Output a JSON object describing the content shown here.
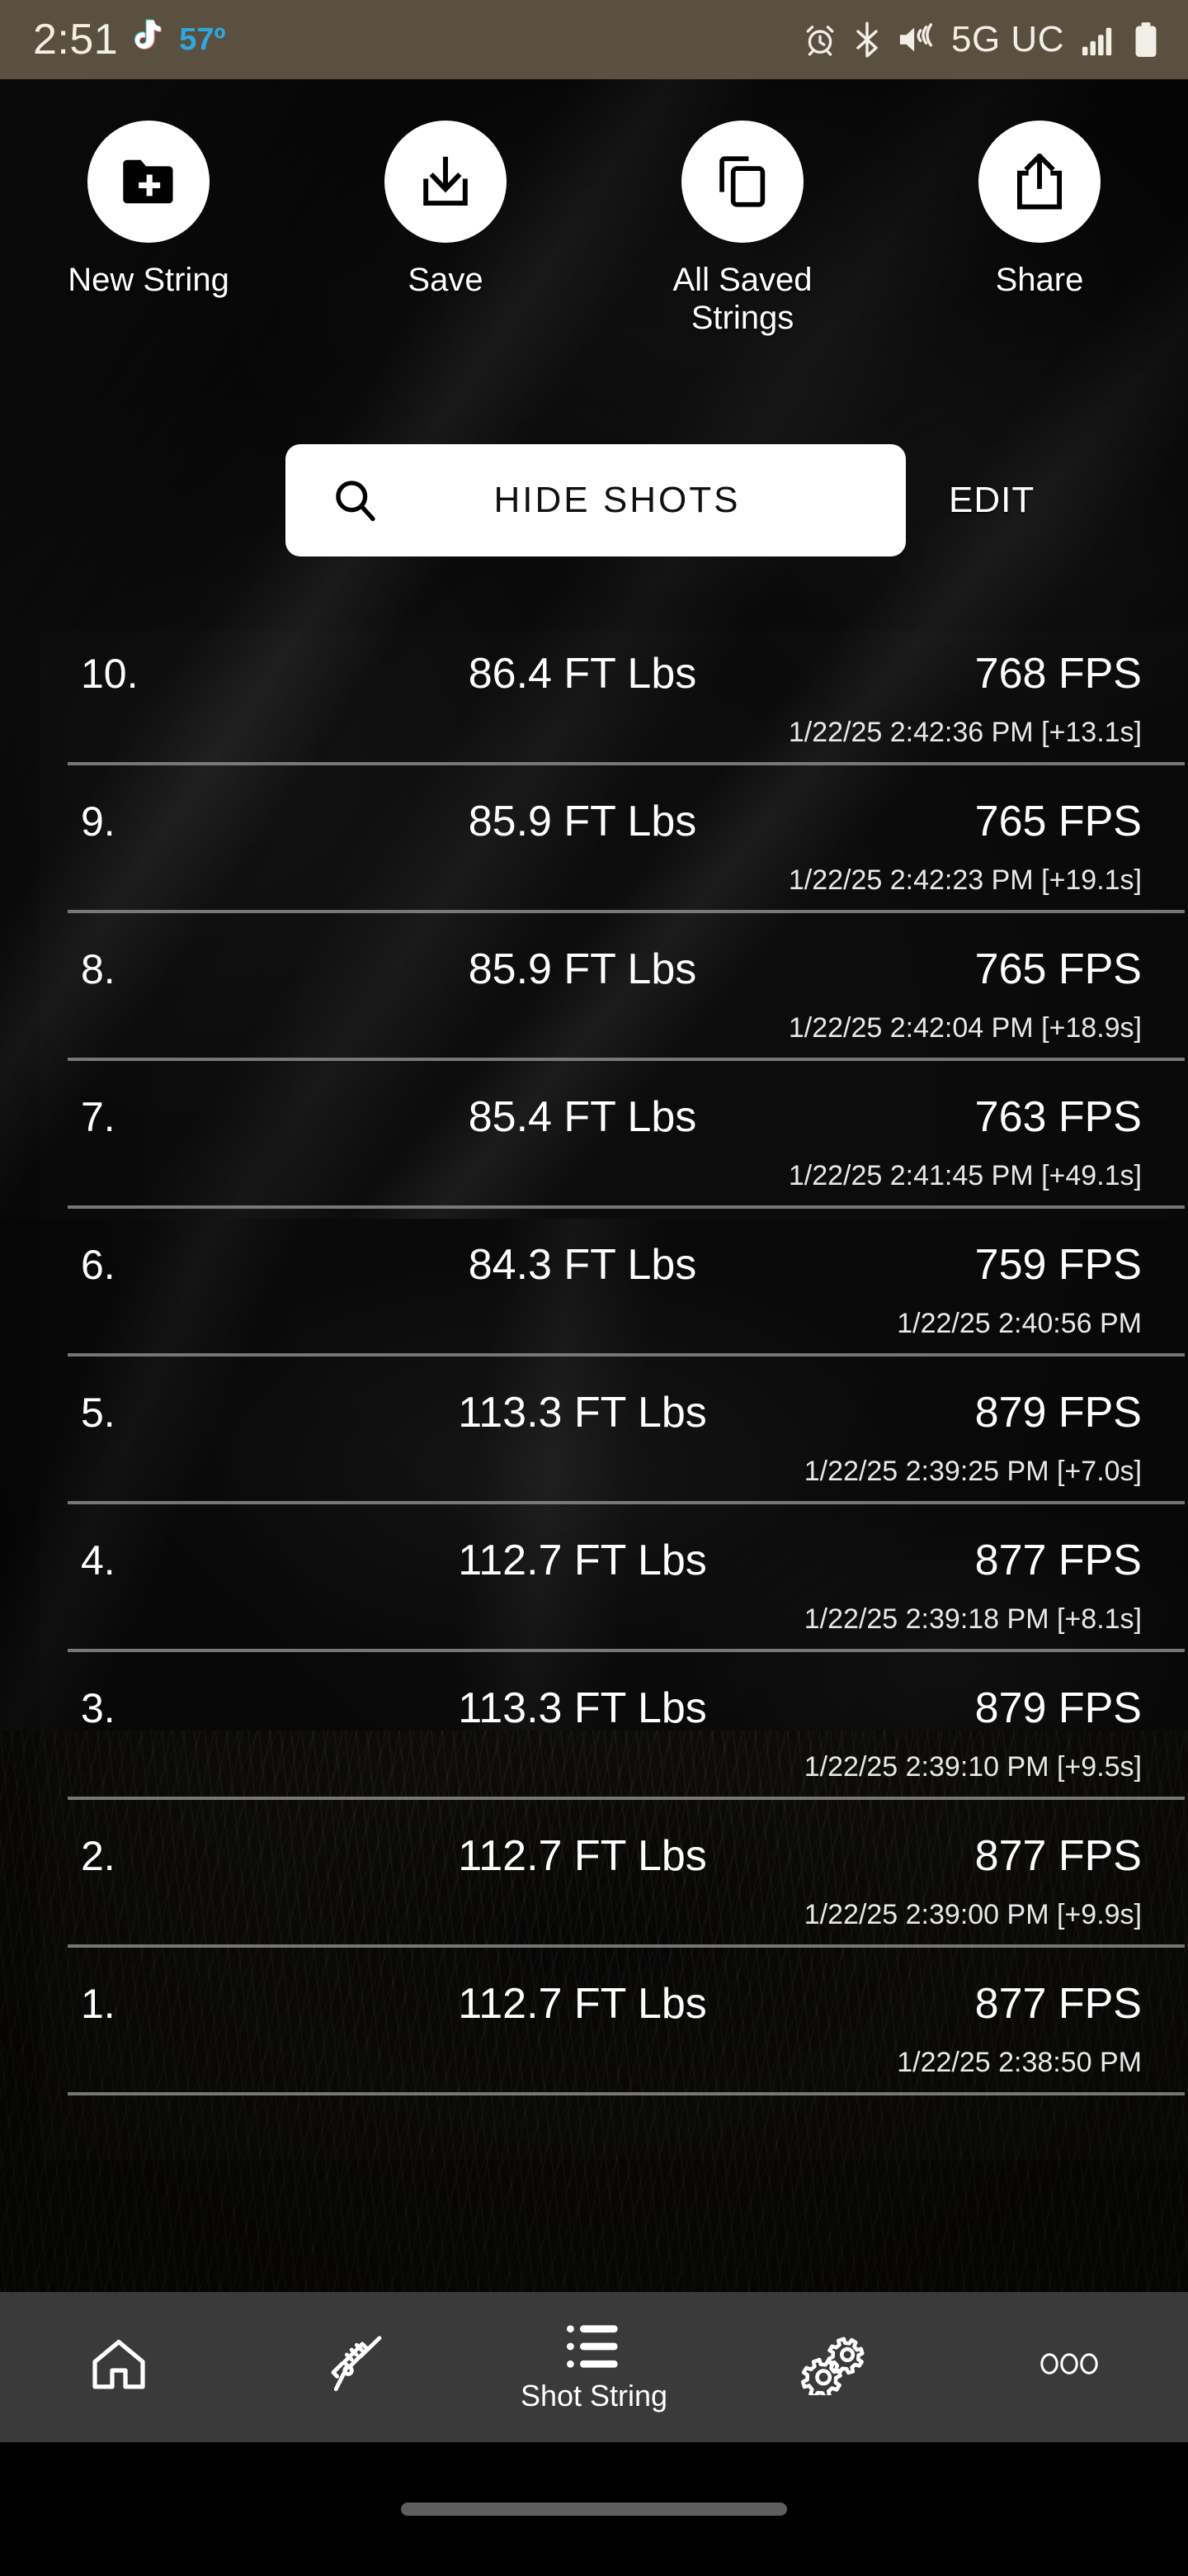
{
  "statusbar": {
    "time": "2:51",
    "temperature": "57º",
    "network": "5G UC",
    "icons": [
      "tiktok-icon",
      "alarm-icon",
      "bluetooth-icon",
      "mute-vibrate-icon",
      "signal-icon",
      "battery-icon"
    ]
  },
  "actions": [
    {
      "label": "New String",
      "icon": "new-folder-icon"
    },
    {
      "label": "Save",
      "icon": "download-save-icon"
    },
    {
      "label": "All Saved Strings",
      "icon": "copy-stack-icon"
    },
    {
      "label": "Share",
      "icon": "share-upload-icon"
    }
  ],
  "toolbar": {
    "hide_shots_label": "HIDE SHOTS",
    "hide_shots_icon": "search-icon",
    "edit_label": "EDIT"
  },
  "shots": [
    {
      "index": "10.",
      "energy": "86.4 FT Lbs",
      "speed": "768 FPS",
      "timestamp": "1/22/25 2:42:36 PM [+13.1s]"
    },
    {
      "index": "9.",
      "energy": "85.9 FT Lbs",
      "speed": "765 FPS",
      "timestamp": "1/22/25 2:42:23 PM [+19.1s]"
    },
    {
      "index": "8.",
      "energy": "85.9 FT Lbs",
      "speed": "765 FPS",
      "timestamp": "1/22/25 2:42:04 PM [+18.9s]"
    },
    {
      "index": "7.",
      "energy": "85.4 FT Lbs",
      "speed": "763 FPS",
      "timestamp": "1/22/25 2:41:45 PM [+49.1s]"
    },
    {
      "index": "6.",
      "energy": "84.3 FT Lbs",
      "speed": "759 FPS",
      "timestamp": "1/22/25 2:40:56 PM"
    },
    {
      "index": "5.",
      "energy": "113.3 FT Lbs",
      "speed": "879 FPS",
      "timestamp": "1/22/25 2:39:25 PM [+7.0s]"
    },
    {
      "index": "4.",
      "energy": "112.7 FT Lbs",
      "speed": "877 FPS",
      "timestamp": "1/22/25 2:39:18 PM [+8.1s]"
    },
    {
      "index": "3.",
      "energy": "113.3 FT Lbs",
      "speed": "879 FPS",
      "timestamp": "1/22/25 2:39:10 PM [+9.5s]"
    },
    {
      "index": "2.",
      "energy": "112.7 FT Lbs",
      "speed": "877 FPS",
      "timestamp": "1/22/25 2:39:00 PM [+9.9s]"
    },
    {
      "index": "1.",
      "energy": "112.7 FT Lbs",
      "speed": "877 FPS",
      "timestamp": "1/22/25 2:38:50 PM"
    }
  ],
  "bottomnav": [
    {
      "label": "",
      "icon": "home-icon",
      "active": false
    },
    {
      "label": "",
      "icon": "rifle-icon",
      "active": false
    },
    {
      "label": "Shot String",
      "icon": "list-icon",
      "active": true
    },
    {
      "label": "",
      "icon": "gears-icon",
      "active": false
    },
    {
      "label": "",
      "icon": "more-dots-icon",
      "active": false
    }
  ],
  "colors": {
    "statusbar_bg": "#5a5040",
    "accent_temp": "#2fa8e0",
    "navbar_bg": "#3a3a3a",
    "button_fill": "#ffffff"
  }
}
